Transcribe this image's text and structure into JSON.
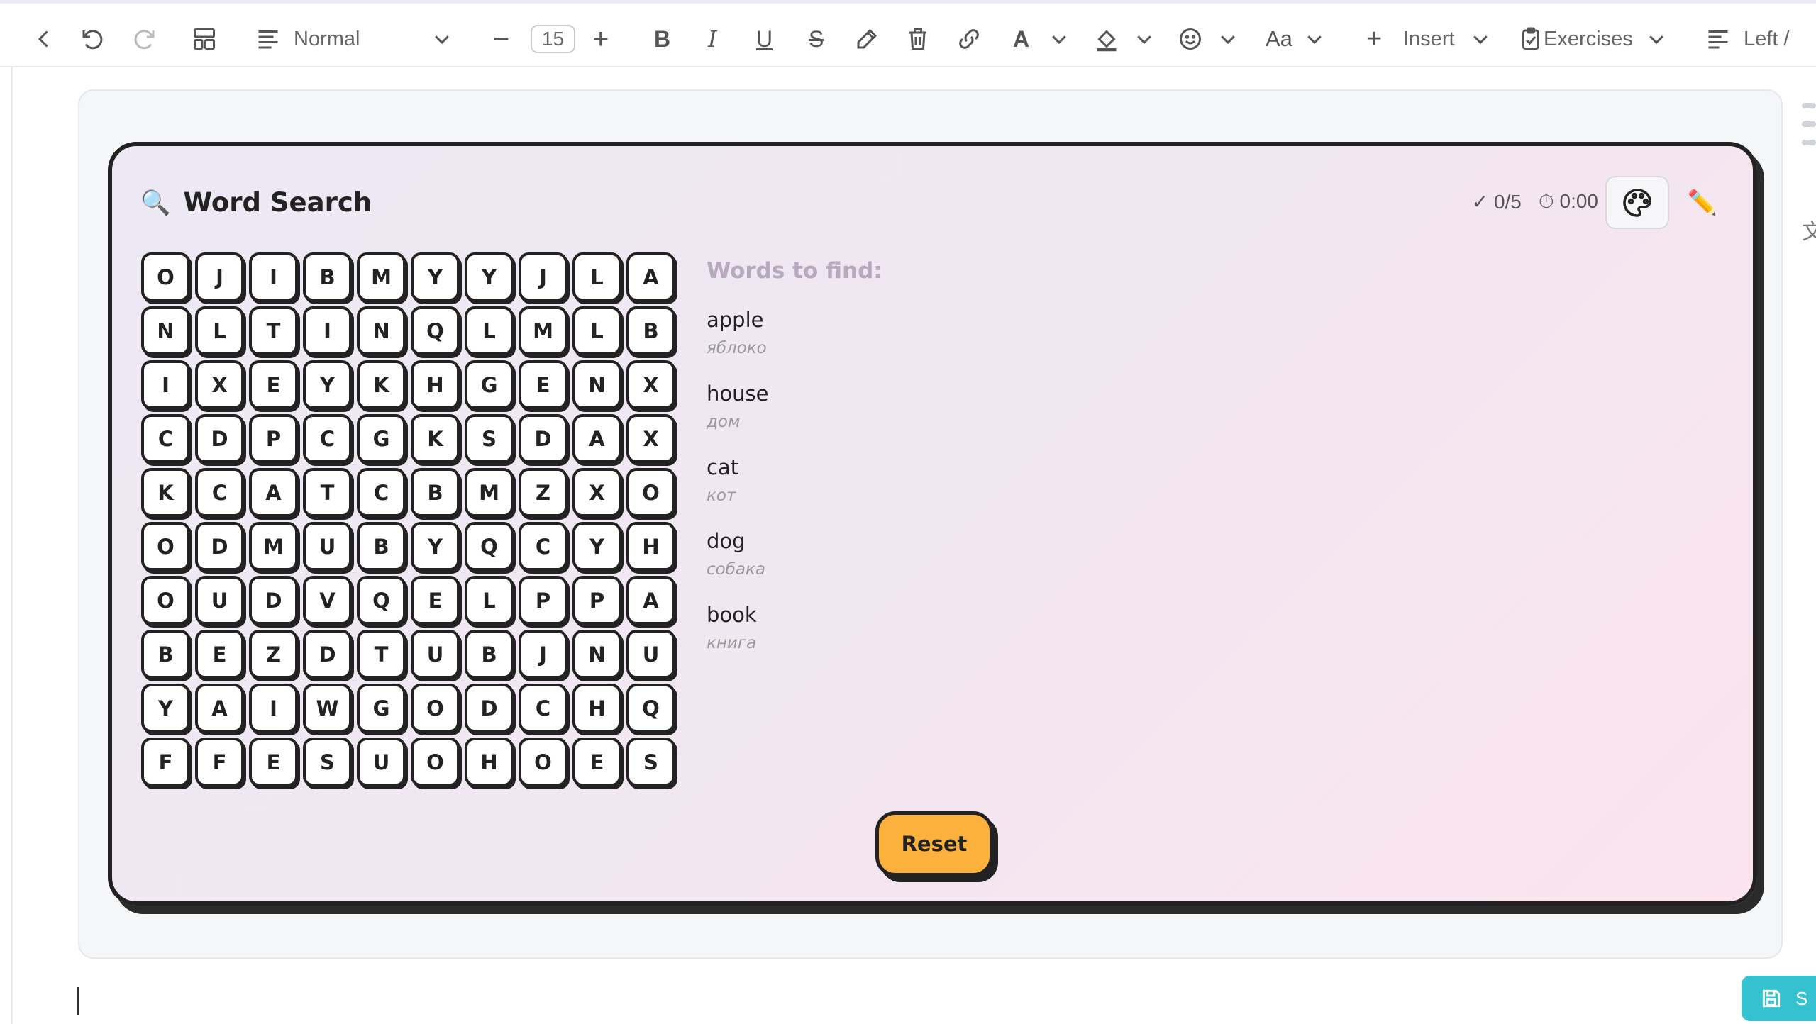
{
  "toolbar": {
    "paragraph_style": "Normal",
    "font_size": "15",
    "font_color_label": "A",
    "case_label": "Aa",
    "insert_label": "Insert",
    "exercises_label": "Exercises",
    "align_label": "Left /",
    "bold_label": "B",
    "italic_label": "I",
    "underline_label": "U",
    "strike_label": "S"
  },
  "game": {
    "title": "Word Search",
    "found": "✓ 0/5",
    "timer": "⏱ 0:00",
    "words_heading": "Words to find:",
    "words": [
      {
        "en": "apple",
        "tr": "яблоко"
      },
      {
        "en": "house",
        "tr": "дом"
      },
      {
        "en": "cat",
        "tr": "кот"
      },
      {
        "en": "dog",
        "tr": "собака"
      },
      {
        "en": "book",
        "tr": "книга"
      }
    ],
    "grid": [
      [
        "O",
        "J",
        "I",
        "B",
        "M",
        "Y",
        "Y",
        "J",
        "L",
        "A"
      ],
      [
        "N",
        "L",
        "T",
        "I",
        "N",
        "Q",
        "L",
        "M",
        "L",
        "B"
      ],
      [
        "I",
        "X",
        "E",
        "Y",
        "K",
        "H",
        "G",
        "E",
        "N",
        "X"
      ],
      [
        "C",
        "D",
        "P",
        "C",
        "G",
        "K",
        "S",
        "D",
        "A",
        "X"
      ],
      [
        "K",
        "C",
        "A",
        "T",
        "C",
        "B",
        "M",
        "Z",
        "X",
        "O"
      ],
      [
        "O",
        "D",
        "M",
        "U",
        "B",
        "Y",
        "Q",
        "C",
        "Y",
        "H"
      ],
      [
        "O",
        "U",
        "D",
        "V",
        "Q",
        "E",
        "L",
        "P",
        "P",
        "A"
      ],
      [
        "B",
        "E",
        "Z",
        "D",
        "T",
        "U",
        "B",
        "J",
        "N",
        "U"
      ],
      [
        "Y",
        "A",
        "I",
        "W",
        "G",
        "O",
        "D",
        "C",
        "H",
        "Q"
      ],
      [
        "F",
        "F",
        "E",
        "S",
        "U",
        "O",
        "H",
        "O",
        "E",
        "S"
      ]
    ],
    "reset_label": "Reset",
    "accent_color": "#fbb13c"
  },
  "save": {
    "label": "S",
    "color": "#35c2d0"
  }
}
